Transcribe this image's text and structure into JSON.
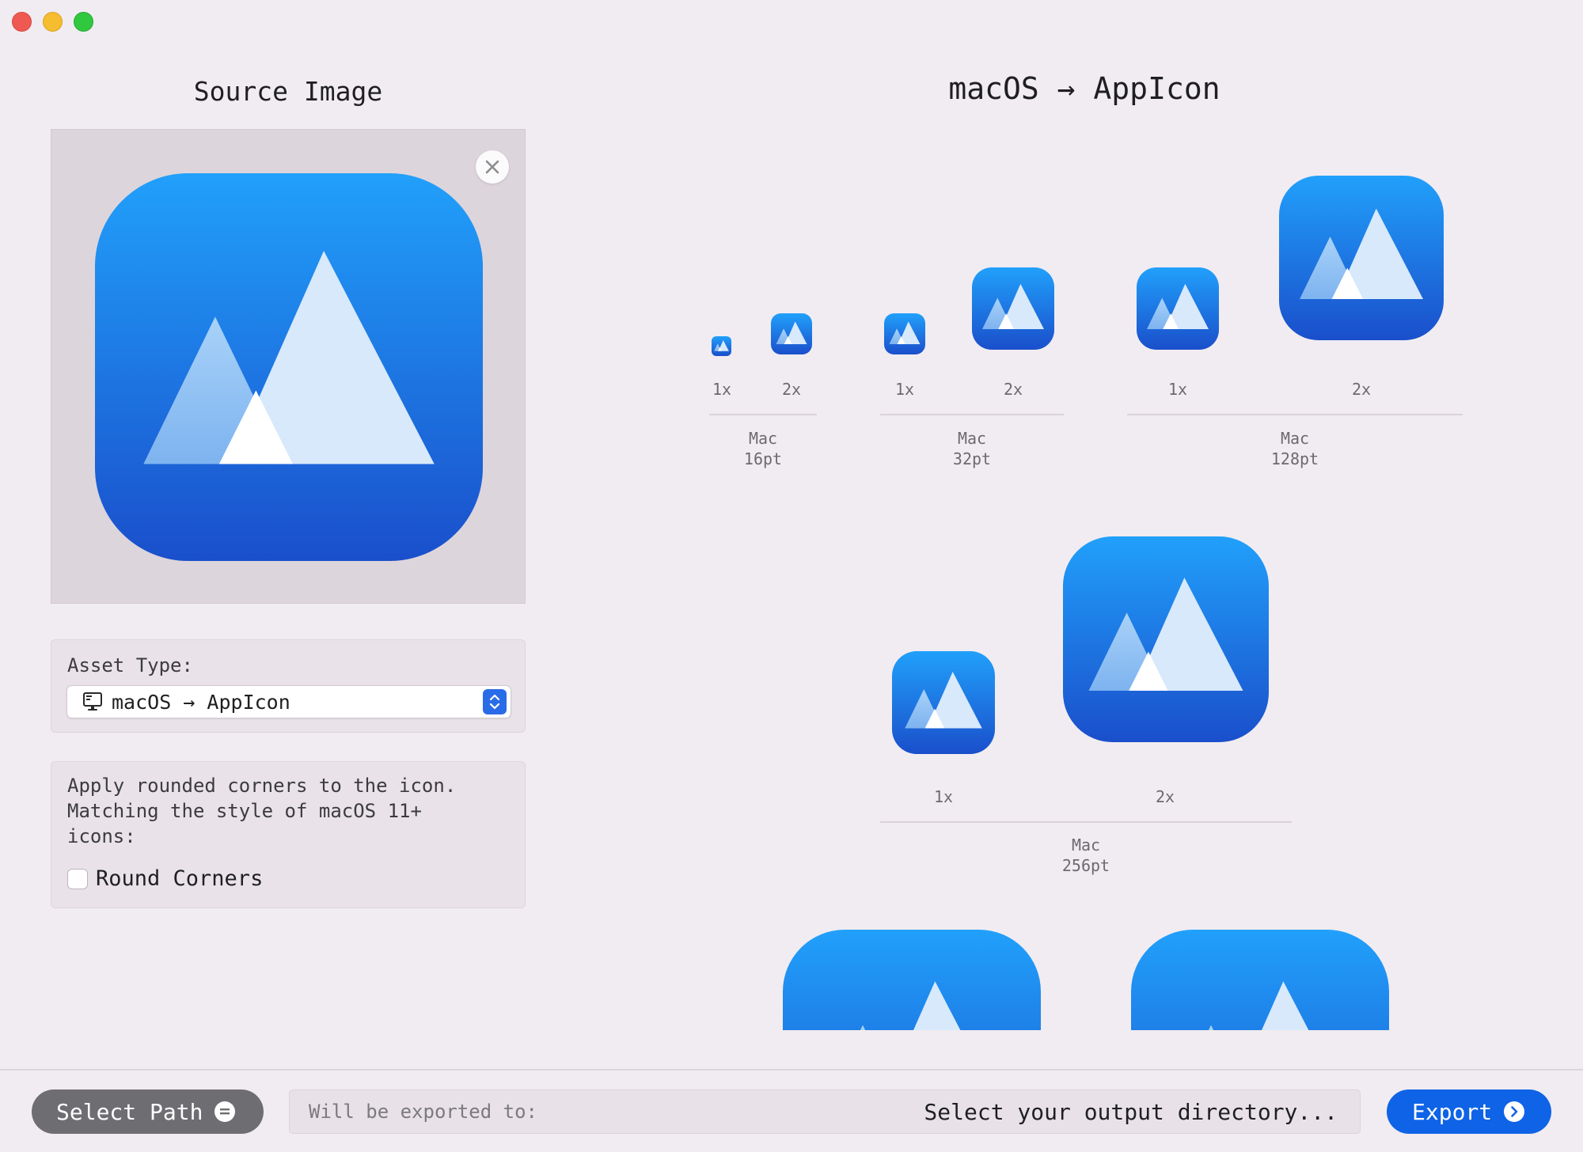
{
  "window": {
    "controls": [
      "close",
      "minimize",
      "zoom"
    ]
  },
  "source": {
    "title": "Source Image",
    "remove_icon": "close-icon"
  },
  "asset_type": {
    "label": "Asset Type:",
    "selected": "macOS → AppIcon",
    "icon": "monitor-icon"
  },
  "round_corners": {
    "description": "Apply rounded corners to the icon.\nMatching the style of macOS 11+\nicons:",
    "checkbox_label": "Round Corners",
    "checked": false
  },
  "preview": {
    "title": "macOS → AppIcon",
    "groups": [
      {
        "device": "Mac",
        "size": "16pt",
        "scales": [
          "1x",
          "2x"
        ]
      },
      {
        "device": "Mac",
        "size": "32pt",
        "scales": [
          "1x",
          "2x"
        ]
      },
      {
        "device": "Mac",
        "size": "128pt",
        "scales": [
          "1x",
          "2x"
        ]
      },
      {
        "device": "Mac",
        "size": "256pt",
        "scales": [
          "1x",
          "2x"
        ]
      }
    ]
  },
  "bottom_bar": {
    "select_path_label": "Select Path",
    "export_prefix": "Will be exported to:",
    "export_path": "Select your output directory...",
    "export_label": "Export"
  },
  "colors": {
    "accent": "#0f63e6",
    "icon_top": "#21a0fb",
    "icon_bottom": "#1a4fcb",
    "background": "#f1ecf1"
  }
}
